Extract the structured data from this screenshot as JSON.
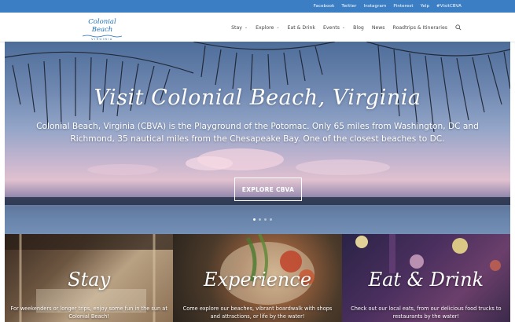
{
  "topbar": {
    "links": [
      "Facebook",
      "Twitter",
      "Instagram",
      "Pinterest",
      "Yelp",
      "#VisitCBVA"
    ]
  },
  "header": {
    "logo_main": "Colonial Beach",
    "logo_sub": "VIRGINIA",
    "nav": [
      {
        "label": "Stay",
        "dropdown": true
      },
      {
        "label": "Explore",
        "dropdown": true
      },
      {
        "label": "Eat & Drink",
        "dropdown": false
      },
      {
        "label": "Events",
        "dropdown": true
      },
      {
        "label": "Blog",
        "dropdown": false
      },
      {
        "label": "News",
        "dropdown": false
      },
      {
        "label": "Roadtrips & Itineraries",
        "dropdown": false
      }
    ],
    "search_icon": "search-icon"
  },
  "hero": {
    "title": "Visit Colonial Beach, Virginia",
    "description": "Colonial Beach, Virginia (CBVA) is the Playground of the Potomac. Only 65 miles from Washington, DC and Richmond, 35 nautical miles from the Chesapeake Bay. One of the closest beaches to DC.",
    "cta_label": "EXPLORE CBVA",
    "slides": 4,
    "active_slide": 1
  },
  "cards": [
    {
      "title": "Stay",
      "description": "For weekenders or longer trips, enjoy some fun in the sun at Colonial Beach!"
    },
    {
      "title": "Experience",
      "description": "Come explore our beaches, vibrant boardwalk with shops and attractions, or life by the water!"
    },
    {
      "title": "Eat & Drink",
      "description": "Check out our local eats, from our delicious food trucks to restaurants by the water!"
    }
  ],
  "colors": {
    "topbar": "#3b7ec4",
    "logo": "#1f6fb4"
  }
}
